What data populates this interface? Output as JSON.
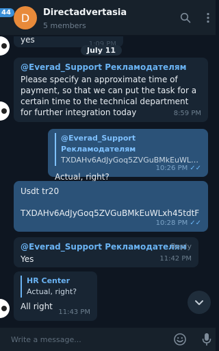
{
  "header": {
    "unread_count": "44",
    "avatar_letter": "D",
    "title": "Directadvertasia",
    "subtitle": "5 members"
  },
  "chat": {
    "date_label": "July 11",
    "messages": [
      {
        "text": "yes",
        "time": "1:09 PM"
      },
      {
        "sender": "@Everad_Support Рекламодателям",
        "text": "Please specify an approximate time of payment, so that we can put the task for a certain time to the technical department for further integration today",
        "time": "8:59 PM"
      },
      {
        "reply_name": "@Everad_Support Рекламодателям",
        "reply_text": "TXDAHv6AdJyGoq5ZVGuBMkEuWLx...",
        "text": "Actual, right?",
        "time": "10:26 PM"
      },
      {
        "line1": "Usdt tr20",
        "line2": "TXDAHv6AdJyGoq5ZVGuBMkEuWLxh45tdtF",
        "time": "10:28 PM"
      },
      {
        "sender": "@Everad_Support Рекламодателям",
        "reply_label": "Reply",
        "text": "Yes",
        "time": "11:42 PM"
      },
      {
        "reply_name": "HR Center",
        "reply_text": "Actual, right?",
        "text": "All right",
        "time": "11:43 PM"
      }
    ]
  },
  "composer": {
    "placeholder": "Write a message..."
  },
  "colors": {
    "background": "#0e1621",
    "panel": "#17212b",
    "incoming_bubble": "#182533",
    "outgoing_bubble": "#2b5278",
    "accent": "#6ab3f3",
    "avatar": "#e88a3a"
  },
  "icons": [
    "search-icon",
    "more-vertical-icon",
    "chevron-down-icon",
    "emoji-icon",
    "microphone-icon",
    "double-check-icon"
  ]
}
